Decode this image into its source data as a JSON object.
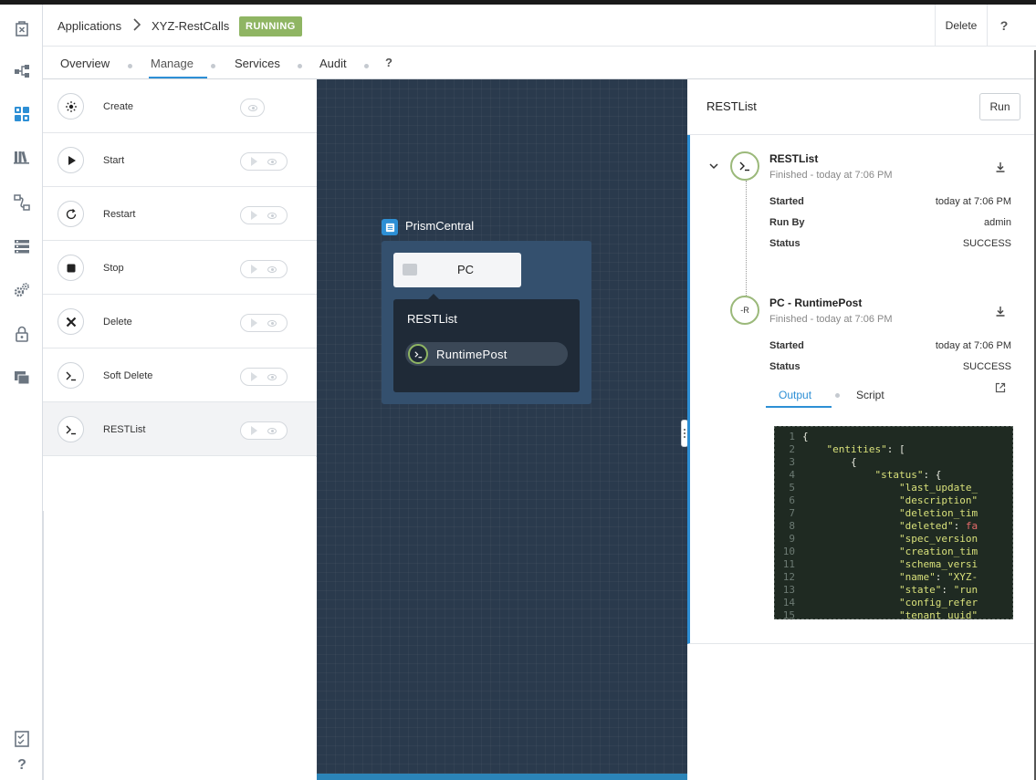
{
  "header": {
    "breadcrumb_root": "Applications",
    "app_name": "XYZ-RestCalls",
    "status": "RUNNING",
    "delete_label": "Delete",
    "help_label": "?"
  },
  "tabs": [
    {
      "label": "Overview"
    },
    {
      "label": "Manage"
    },
    {
      "label": "Services"
    },
    {
      "label": "Audit"
    }
  ],
  "tabs_help": "?",
  "actions": [
    {
      "label": "Create",
      "icon": "sun-icon"
    },
    {
      "label": "Start",
      "icon": "play-icon"
    },
    {
      "label": "Restart",
      "icon": "restart-icon"
    },
    {
      "label": "Stop",
      "icon": "stop-icon"
    },
    {
      "label": "Delete",
      "icon": "x-icon"
    },
    {
      "label": "Soft Delete",
      "icon": "terminal-icon"
    },
    {
      "label": "RESTList",
      "icon": "terminal-icon"
    }
  ],
  "canvas": {
    "service_title": "PrismCentral",
    "substrate_label": "PC",
    "action_title": "RESTList",
    "task_label": "RuntimePost"
  },
  "run_panel": {
    "title": "RESTList",
    "run_label": "Run",
    "task1": {
      "name": "RESTList",
      "subtitle": "Finished - today at 7:06 PM",
      "started_key": "Started",
      "started_val": "today at 7:06 PM",
      "runby_key": "Run By",
      "runby_val": "admin",
      "status_key": "Status",
      "status_val": "SUCCESS"
    },
    "task2": {
      "name": "PC - RuntimePost",
      "subtitle": "Finished - today at 7:06 PM",
      "icon_text": "-R",
      "started_key": "Started",
      "started_val": "today at 7:06 PM",
      "status_key": "Status",
      "status_val": "SUCCESS"
    },
    "output_tab": "Output",
    "script_tab": "Script"
  },
  "code_lines": [
    "{",
    "    \"entities\": [",
    "        {",
    "            \"status\": {",
    "                \"last_update_",
    "                \"description\"",
    "                \"deletion_tim",
    "                \"deleted\": fa",
    "                \"spec_version",
    "                \"creation_tim",
    "                \"schema_versi",
    "                \"name\": \"XYZ-",
    "                \"state\": \"run",
    "                \"config_refer",
    "                \"tenant_uuid\""
  ],
  "colors": {
    "accent": "#2d8fd5",
    "running": "#8fb563",
    "canvas": "#2a3a4d"
  }
}
